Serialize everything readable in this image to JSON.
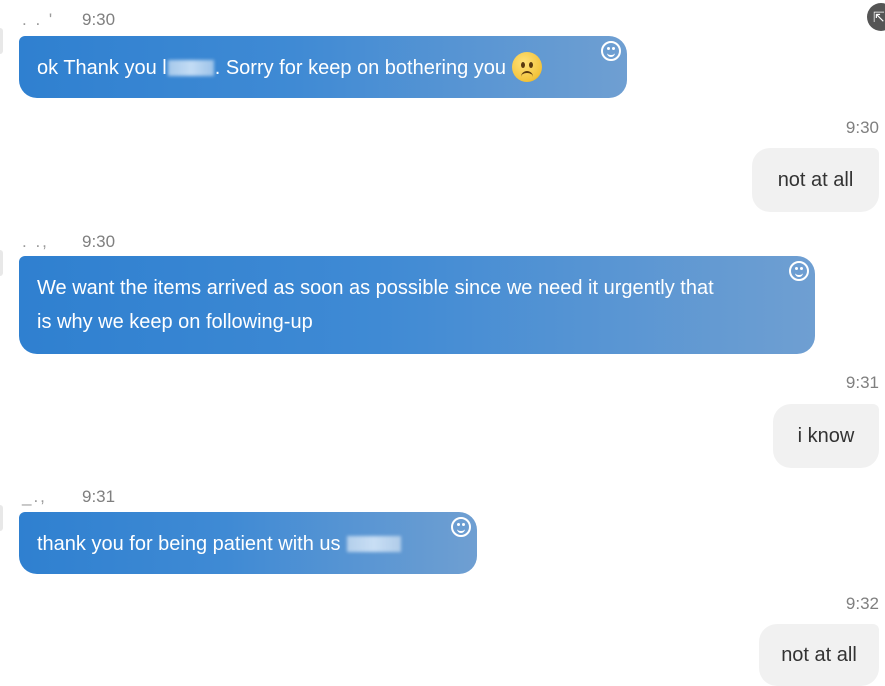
{
  "messages": [
    {
      "direction": "incoming",
      "sender": ". .  '",
      "time": "9:30",
      "text_before": "ok Thank you l",
      "text_after": ". Sorry for keep on bothering you",
      "emoji": "sad-face-emoji"
    },
    {
      "direction": "outgoing",
      "time": "9:30",
      "text": "not at all"
    },
    {
      "direction": "incoming",
      "sender": ".  .,",
      "time": "9:30",
      "line1": "We want the items arrived as soon as possible since we need it urgently that",
      "line2": "is why we keep on following-up"
    },
    {
      "direction": "outgoing",
      "time": "9:31",
      "text": "i know"
    },
    {
      "direction": "incoming",
      "sender": "_.,",
      "time": "9:31",
      "text_before": "thank you for being patient with us "
    },
    {
      "direction": "outgoing",
      "time": "9:32",
      "text": "not at all"
    }
  ],
  "icons": {
    "reaction": "smiley-reaction-icon",
    "corner": "share-icon"
  },
  "colors": {
    "incoming_start": "#2f80d0",
    "incoming_end": "#6f9fd2",
    "outgoing_bg": "#f1f1f1",
    "timestamp": "#7f7f7f"
  }
}
